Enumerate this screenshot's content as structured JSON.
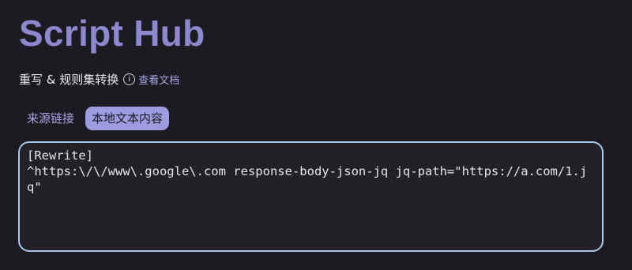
{
  "header": {
    "title": "Script Hub",
    "subtitle": "重写 & 规则集转换",
    "info_icon": "①",
    "docs_link": "查看文档"
  },
  "tabs": [
    {
      "label": "来源链接",
      "active": false
    },
    {
      "label": "本地文本内容",
      "active": true
    }
  ],
  "editor": {
    "content": "[Rewrite]\n^https:\\/\\/www\\.google\\.com response-body-json-jq jq-path=\"https://a.com/1.jq\""
  },
  "colors": {
    "background": "#1c1b22",
    "accent": "#8d88d0",
    "tab_active_bg": "#9f9be0",
    "editor_border": "#a9c5ea"
  }
}
